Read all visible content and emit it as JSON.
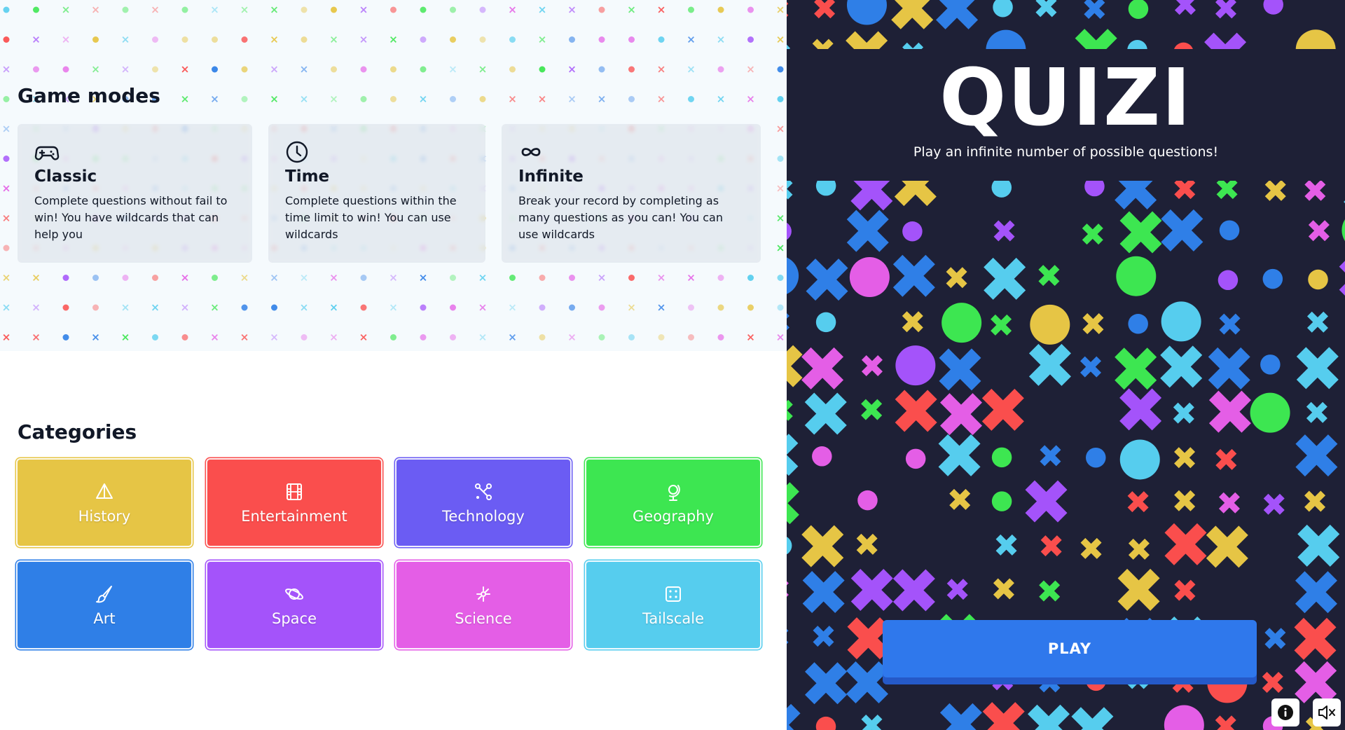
{
  "left": {
    "game_modes": {
      "title": "Game modes",
      "modes": [
        {
          "icon": "gamepad-icon",
          "name": "Classic",
          "description": "Complete questions without fail to win! You have wildcards that can help you"
        },
        {
          "icon": "clock-icon",
          "name": "Time",
          "description": "Complete questions within the time limit to win! You can use wildcards"
        },
        {
          "icon": "infinity-icon",
          "name": "Infinite",
          "description": "Break your record by completing as many questions as you can! You can use wildcards"
        }
      ]
    },
    "categories": {
      "title": "Categories",
      "items": [
        {
          "label": "History",
          "icon": "pyramid-icon",
          "color": "#e6c545"
        },
        {
          "label": "Entertainment",
          "icon": "film-icon",
          "color": "#fa4e4d"
        },
        {
          "label": "Technology",
          "icon": "network-icon",
          "color": "#6b5cf3"
        },
        {
          "label": "Geography",
          "icon": "globe-icon",
          "color": "#3de651"
        },
        {
          "label": "Art",
          "icon": "brush-icon",
          "color": "#2f7fe7"
        },
        {
          "label": "Space",
          "icon": "planet-icon",
          "color": "#a453fa"
        },
        {
          "label": "Science",
          "icon": "atom-icon",
          "color": "#e45ee6"
        },
        {
          "label": "Tailscale",
          "icon": "dice-icon",
          "color": "#56cdee"
        }
      ]
    }
  },
  "right": {
    "logo": "QUIZI",
    "subtitle": "Play an infinite number of possible questions!",
    "play_label": "PLAY",
    "info_icon": "info-icon",
    "mute_icon": "speaker-muted-icon"
  },
  "palette": {
    "background_dark": "#1e2036",
    "play_button": "#2f78ec",
    "shape_colors": [
      "#e6c545",
      "#fa4e4d",
      "#3de651",
      "#2f7fe7",
      "#a453fa",
      "#e45ee6",
      "#56cdee"
    ]
  }
}
